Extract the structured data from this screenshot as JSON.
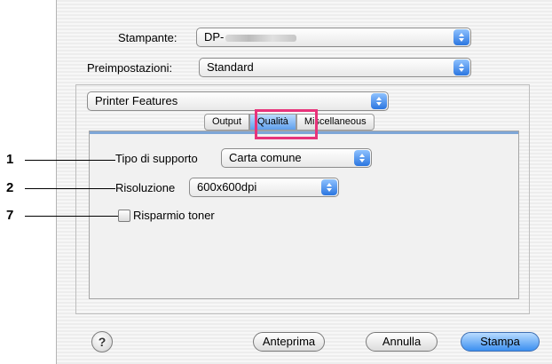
{
  "printer": {
    "label": "Stampante:",
    "value": "DP-"
  },
  "presets": {
    "label": "Preimpostazioni:",
    "value": "Standard"
  },
  "section_popup": {
    "value": "Printer Features"
  },
  "tabs": [
    {
      "label": "Output"
    },
    {
      "label": "Qualità",
      "selected": true
    },
    {
      "label": "Miscellaneous"
    }
  ],
  "fields": {
    "media_type": {
      "label": "Tipo di supporto",
      "value": "Carta comune"
    },
    "resolution": {
      "label": "Risoluzione",
      "value": "600x600dpi"
    },
    "toner_saver": {
      "label": "Risparmio toner",
      "checked": false
    }
  },
  "callouts": [
    {
      "number": "1"
    },
    {
      "number": "2"
    },
    {
      "number": "7"
    }
  ],
  "buttons": {
    "help": "?",
    "preview": "Anteprima",
    "cancel": "Annulla",
    "print": "Stampa"
  },
  "colors": {
    "accent": "#2b76e0",
    "highlight": "#e8337a",
    "panel_line": "#7ea6d7"
  },
  "icons": {
    "popup_arrows": "popup-arrows-icon",
    "help": "help-icon",
    "checkbox": "checkbox-icon"
  }
}
